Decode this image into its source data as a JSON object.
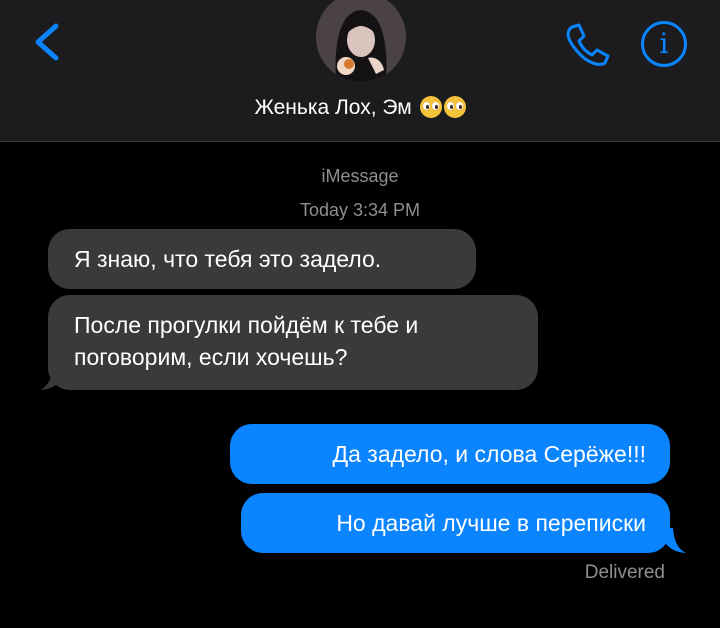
{
  "header": {
    "contact_name": "Женька Лох, Эм",
    "emoji": [
      "pleading-face-emoji",
      "pleading-face-emoji"
    ]
  },
  "thread": {
    "service": "iMessage",
    "timestamp": "Today 3:34 PM"
  },
  "messages": {
    "incoming": [
      "Я знаю, что тебя это задело.",
      "После прогулки пойдём к тебе и поговорим, если хочешь?"
    ],
    "outgoing": [
      "Да задело, и слова Серёже!!!",
      "Но давай лучше в переписки"
    ],
    "status": "Delivered"
  },
  "colors": {
    "accent": "#0a84ff",
    "incoming_bubble": "#3a3a3c",
    "header_bg": "#1c1c1e",
    "meta_text": "#8e8e93"
  }
}
